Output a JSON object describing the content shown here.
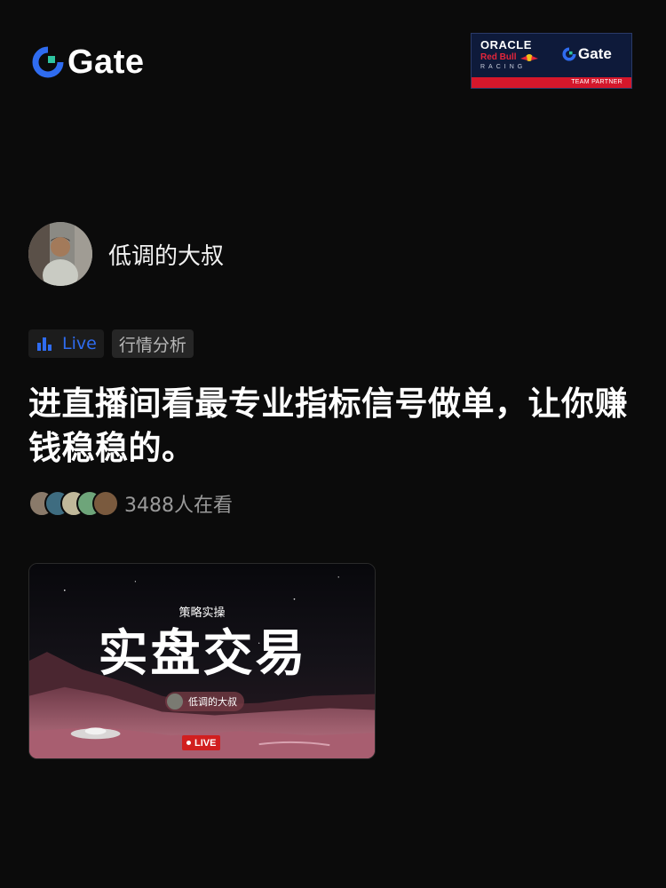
{
  "brand": {
    "name": "Gate",
    "accent": "#2ec4a0",
    "blue": "#2f6cf0"
  },
  "partner": {
    "oracle": "ORACLE",
    "redbull": "Red Bull",
    "racing": "RACING",
    "gate": "Gate",
    "caption": "TEAM PARTNER"
  },
  "author": {
    "name": "低调的大叔"
  },
  "tags": {
    "live": "Live",
    "category": "行情分析"
  },
  "headline": "进直播间看最专业指标信号做单，让你赚钱稳稳的。",
  "viewers": {
    "text": "3488人在看"
  },
  "card": {
    "subtitle": "策略实操",
    "title": "实盘交易",
    "host": "低调的大叔",
    "live_badge": "LIVE"
  }
}
